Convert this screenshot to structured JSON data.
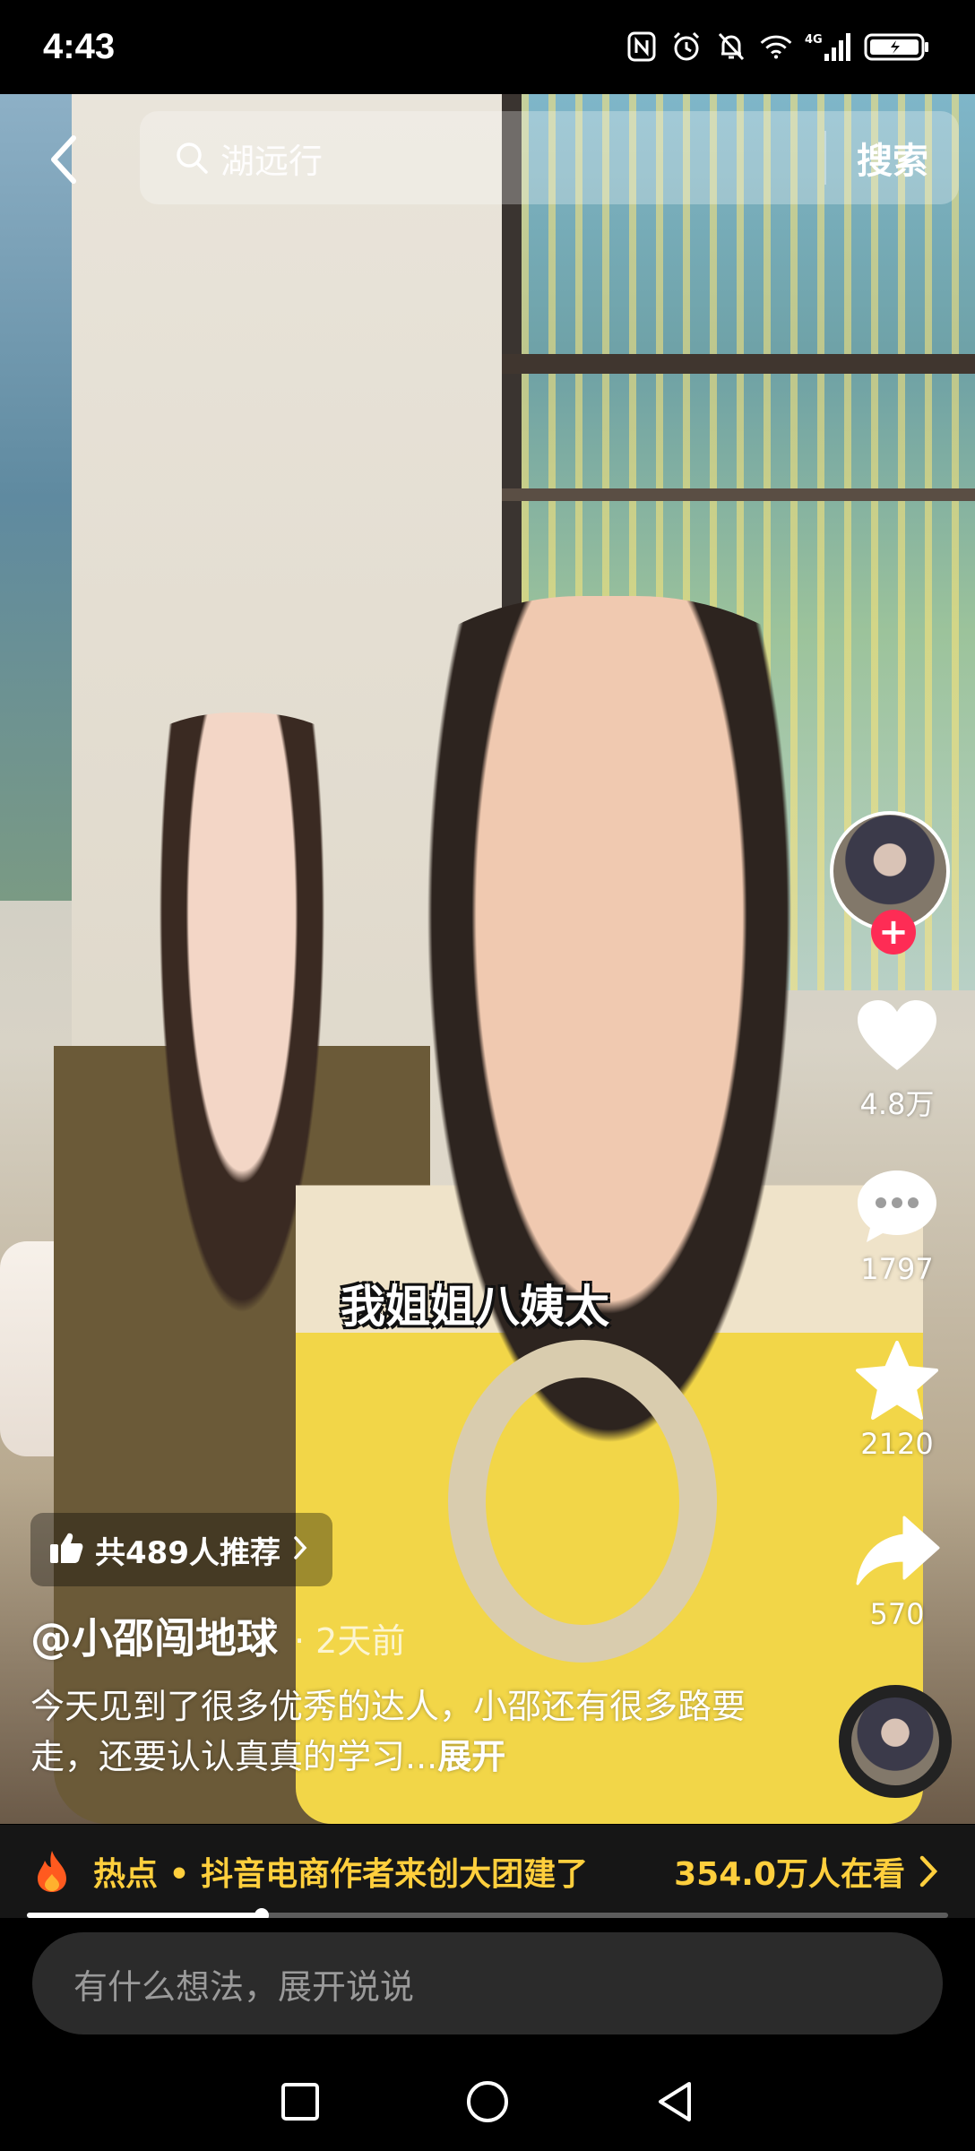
{
  "status_bar": {
    "time": "4:43",
    "icons": [
      "nfc-icon",
      "alarm-icon",
      "mute-icon",
      "wifi-icon",
      "signal-4g-icon",
      "battery-icon"
    ]
  },
  "search": {
    "query": "湖远行",
    "button_label": "搜索"
  },
  "video": {
    "subtitle": "我姐姐八姨太"
  },
  "actions": {
    "likes": "4.8万",
    "comments": "1797",
    "favorites": "2120",
    "shares": "570",
    "follow_symbol": "+"
  },
  "recommend": {
    "label": "共489人推荐"
  },
  "post": {
    "author": "@小邵闯地球",
    "time_ago": "· 2天前",
    "description": "今天见到了很多优秀的达人，小邵还有很多路要走，还要认认真真的学习...",
    "expand_label": "展开"
  },
  "hot_banner": {
    "text": "热点 • 抖音电商作者来创大团建了",
    "viewers": "354.0万人在看"
  },
  "playback": {
    "progress": 0.255
  },
  "comment": {
    "placeholder": "有什么想法，展开说说"
  },
  "colors": {
    "accent_red": "#fe2c55",
    "hot_yellow": "#ffcf3d"
  }
}
